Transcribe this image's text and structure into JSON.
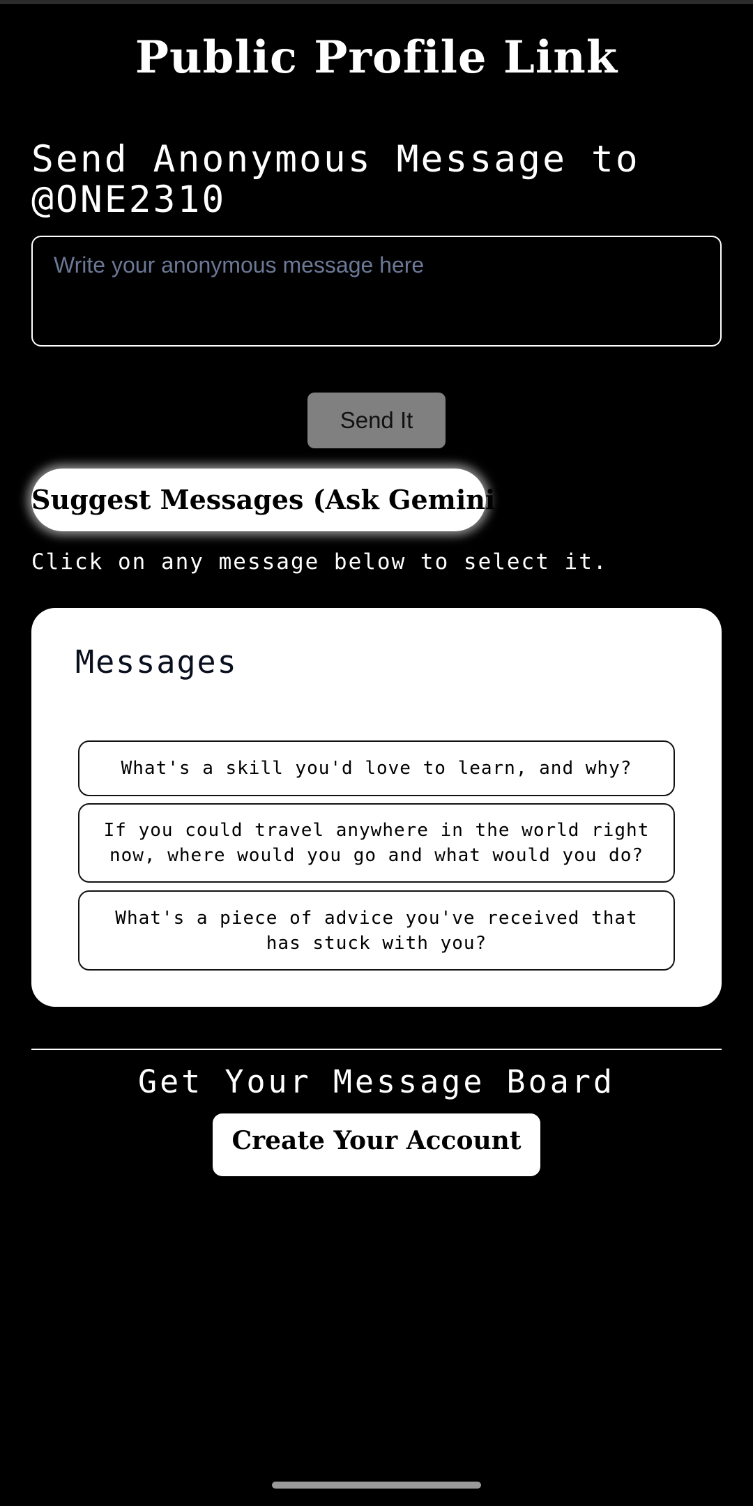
{
  "header": {
    "title": "Public Profile Link"
  },
  "send_form": {
    "heading": "Send Anonymous Message to @ONE2310",
    "input_value": "",
    "input_placeholder": "Write your anonymous message here",
    "send_label": "Send It"
  },
  "suggest": {
    "button_label": "Suggest Messages (Ask Gemini)",
    "instruction": "Click on any message below to select it."
  },
  "messages_card": {
    "title": "Messages",
    "items": [
      "What's a skill you'd love to learn, and why?",
      "If you could travel anywhere in the world right now, where would you go and what would you do?",
      "What's a piece of advice you've received that has stuck with you?"
    ]
  },
  "footer": {
    "heading": "Get Your Message Board",
    "create_label": "Create Your Account"
  },
  "colors": {
    "background": "#000000",
    "foreground": "#ffffff",
    "send_button": "#808080",
    "placeholder": "#6b7896"
  }
}
